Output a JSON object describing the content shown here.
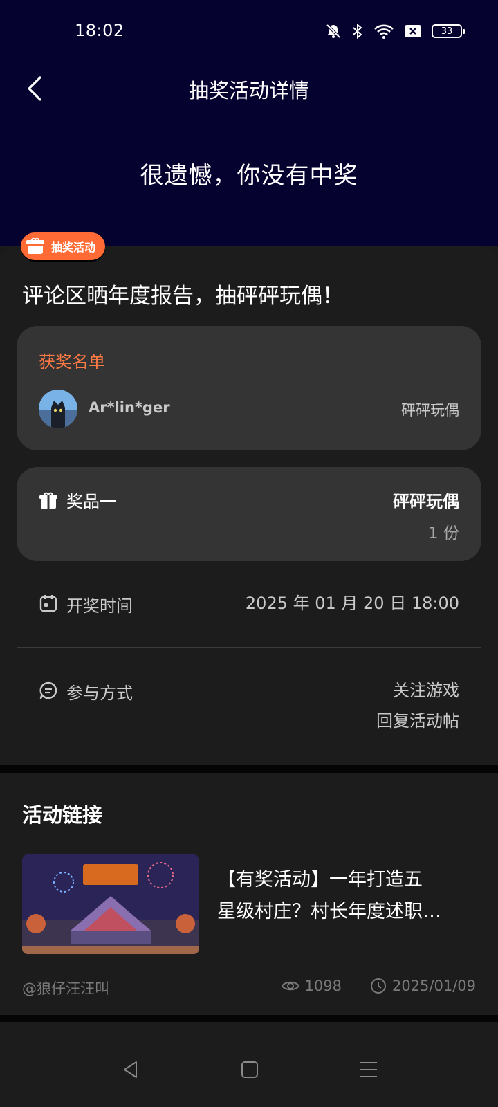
{
  "status_bar": {
    "time": "18:02",
    "battery": "33",
    "icons": [
      "bell-muted-icon",
      "bluetooth-icon",
      "wifi-icon",
      "close-box-icon",
      "battery-icon"
    ]
  },
  "header": {
    "back_icon": "chevron-left-icon",
    "title": "抽奖活动详情",
    "result": "很遗憾，你没有中奖"
  },
  "activity": {
    "badge": "抽奖活动",
    "title": "评论区晒年度报告，抽砰砰玩偶！"
  },
  "winners": {
    "heading": "获奖名单",
    "list": [
      {
        "name": "Ar*lin*ger",
        "prize": "砰砰玩偶"
      }
    ]
  },
  "prize": {
    "label": "奖品一",
    "name": "砰砰玩偶",
    "quantity": "1 份"
  },
  "draw_time": {
    "label": "开奖时间",
    "value": "2025 年 01 月 20 日 18:00"
  },
  "participation": {
    "label": "参与方式",
    "methods": [
      "关注游戏",
      "回复活动帖"
    ]
  },
  "links": {
    "heading": "活动链接",
    "items": [
      {
        "title_line1": "【有奖活动】一年打造五",
        "title_line2": "星级村庄？村长年度述职…",
        "author": "@狼仔汪汪叫",
        "views": "1098",
        "date": "2025/01/09"
      }
    ]
  },
  "colors": {
    "header_bg": "#06022f",
    "accent_orange": "#ff6a35",
    "card_bg": "#343434",
    "page_bg": "#1c1c1c"
  }
}
